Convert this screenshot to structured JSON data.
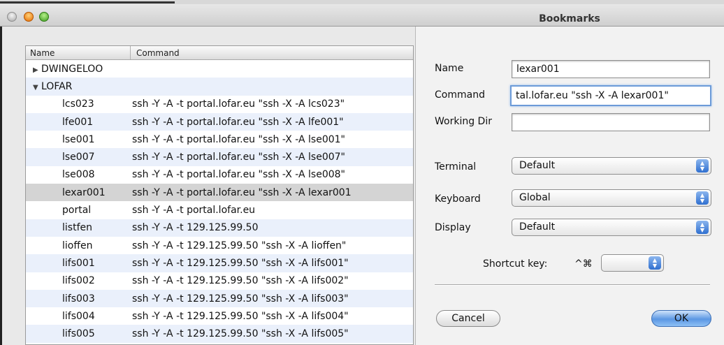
{
  "window": {
    "title": "Bookmarks"
  },
  "list": {
    "columns": {
      "name": "Name",
      "command": "Command"
    },
    "groups": [
      {
        "label": "DWINGELOO",
        "expanded": false
      },
      {
        "label": "LOFAR",
        "expanded": true
      }
    ],
    "rows": [
      {
        "name": "lcs023",
        "command": "ssh -Y -A -t portal.lofar.eu \"ssh -X -A lcs023\""
      },
      {
        "name": "lfe001",
        "command": "ssh -Y -A -t portal.lofar.eu \"ssh -X -A lfe001\""
      },
      {
        "name": "lse001",
        "command": "ssh -Y -A -t portal.lofar.eu \"ssh -X -A lse001\""
      },
      {
        "name": "lse007",
        "command": "ssh -Y -A -t portal.lofar.eu \"ssh -X -A lse007\""
      },
      {
        "name": "lse008",
        "command": "ssh -Y -A -t portal.lofar.eu \"ssh -X -A lse008\""
      },
      {
        "name": "lexar001",
        "command": "ssh -Y -A -t portal.lofar.eu \"ssh -X -A lexar001"
      },
      {
        "name": "portal",
        "command": "ssh -Y -A -t portal.lofar.eu"
      },
      {
        "name": "listfen",
        "command": "ssh -Y -A -t 129.125.99.50"
      },
      {
        "name": "lioffen",
        "command": "ssh -Y -A -t 129.125.99.50 \"ssh -X -A lioffen\""
      },
      {
        "name": "lifs001",
        "command": "ssh -Y -A -t 129.125.99.50 \"ssh -X -A lifs001\""
      },
      {
        "name": "lifs002",
        "command": "ssh -Y -A -t 129.125.99.50 \"ssh -X -A lifs002\""
      },
      {
        "name": "lifs003",
        "command": "ssh -Y -A -t 129.125.99.50 \"ssh -X -A lifs003\""
      },
      {
        "name": "lifs004",
        "command": "ssh -Y -A -t 129.125.99.50 \"ssh -X -A lifs004\""
      },
      {
        "name": "lifs005",
        "command": "ssh -Y -A -t 129.125.99.50 \"ssh -X -A lifs005\""
      }
    ]
  },
  "form": {
    "name_label": "Name",
    "name_value": "lexar001",
    "command_label": "Command",
    "command_value": "tal.lofar.eu \"ssh -X -A lexar001\"",
    "working_dir_label": "Working Dir",
    "working_dir_value": "",
    "terminal_label": "Terminal",
    "terminal_value": "Default",
    "keyboard_label": "Keyboard",
    "keyboard_value": "Global",
    "display_label": "Display",
    "display_value": "Default",
    "shortcut_label": "Shortcut key:",
    "shortcut_modifiers": "^⌘",
    "shortcut_value": "",
    "cancel_label": "Cancel",
    "ok_label": "OK"
  }
}
